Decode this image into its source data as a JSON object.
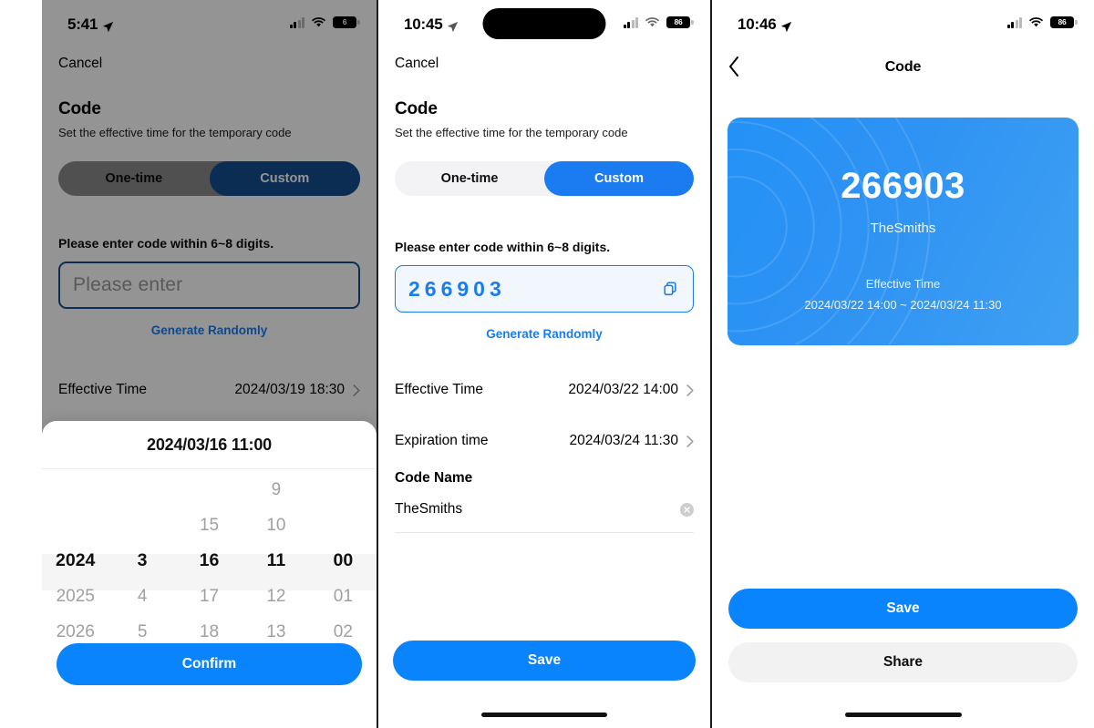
{
  "panel1": {
    "status": {
      "time": "5:41",
      "battery": "6",
      "location_icon": "location-arrow-icon",
      "wifi_icon": "wifi-icon",
      "signal_icon": "cellular-signal-icon"
    },
    "cancel_label": "Cancel",
    "title": "Code",
    "subtitle": "Set the effective time for the temporary code",
    "segmented": {
      "option_one": "One-time",
      "option_two": "Custom",
      "selected": "Custom"
    },
    "hint": "Please enter code within 6~8 digits.",
    "code_input": {
      "value": "",
      "placeholder": "Please enter"
    },
    "generate_label": "Generate Randomly",
    "effective_row": {
      "label": "Effective Time",
      "value": "2024/03/19 18:30"
    },
    "picker": {
      "header": "2024/03/16 11:00",
      "columns": [
        "year",
        "month",
        "day",
        "hour",
        "minute"
      ],
      "rows": [
        {
          "selected": false,
          "cells": [
            "",
            "",
            "",
            "9",
            ""
          ]
        },
        {
          "selected": false,
          "cells": [
            "",
            "",
            "15",
            "10",
            ""
          ]
        },
        {
          "selected": true,
          "cells": [
            "2024",
            "3",
            "16",
            "11",
            "00"
          ]
        },
        {
          "selected": false,
          "cells": [
            "2025",
            "4",
            "17",
            "12",
            "01"
          ]
        },
        {
          "selected": false,
          "cells": [
            "2026",
            "5",
            "18",
            "13",
            "02"
          ]
        }
      ],
      "confirm_label": "Confirm"
    }
  },
  "panel2": {
    "status": {
      "time": "10:45",
      "battery": "86",
      "location_icon": "location-arrow-icon",
      "wifi_icon": "wifi-icon",
      "signal_icon": "cellular-signal-icon"
    },
    "cancel_label": "Cancel",
    "title": "Code",
    "subtitle": "Set the effective time for the temporary code",
    "segmented": {
      "option_one": "One-time",
      "option_two": "Custom",
      "selected": "Custom"
    },
    "hint": "Please enter code within 6~8 digits.",
    "code_input": {
      "value": "266903",
      "placeholder": "Please enter"
    },
    "copy_icon": "copy-icon",
    "generate_label": "Generate Randomly",
    "effective_row": {
      "label": "Effective Time",
      "value": "2024/03/22 14:00"
    },
    "expiration_row": {
      "label": "Expiration time",
      "value": "2024/03/24 11:30"
    },
    "code_name": {
      "label": "Code Name",
      "value": "TheSmiths",
      "clear_icon": "clear-circle-icon"
    },
    "save_label": "Save"
  },
  "panel3": {
    "status": {
      "time": "10:46",
      "battery": "86",
      "location_icon": "location-arrow-icon",
      "wifi_icon": "wifi-icon",
      "signal_icon": "cellular-signal-icon"
    },
    "nav": {
      "back_icon": "chevron-left-icon",
      "title": "Code"
    },
    "card": {
      "code": "266903",
      "name": "TheSmiths",
      "effective_label": "Effective Time",
      "effective_range": "2024/03/22 14:00 ~ 2024/03/24 11:30"
    },
    "save_label": "Save",
    "share_label": "Share"
  },
  "colors": {
    "accent_blue": "#0a84fd",
    "link_blue": "#1a7cf0",
    "card_blue": "#2f93f3",
    "segment_bg": "#f3f3f5",
    "secondary_btn": "#f2f2f3"
  }
}
